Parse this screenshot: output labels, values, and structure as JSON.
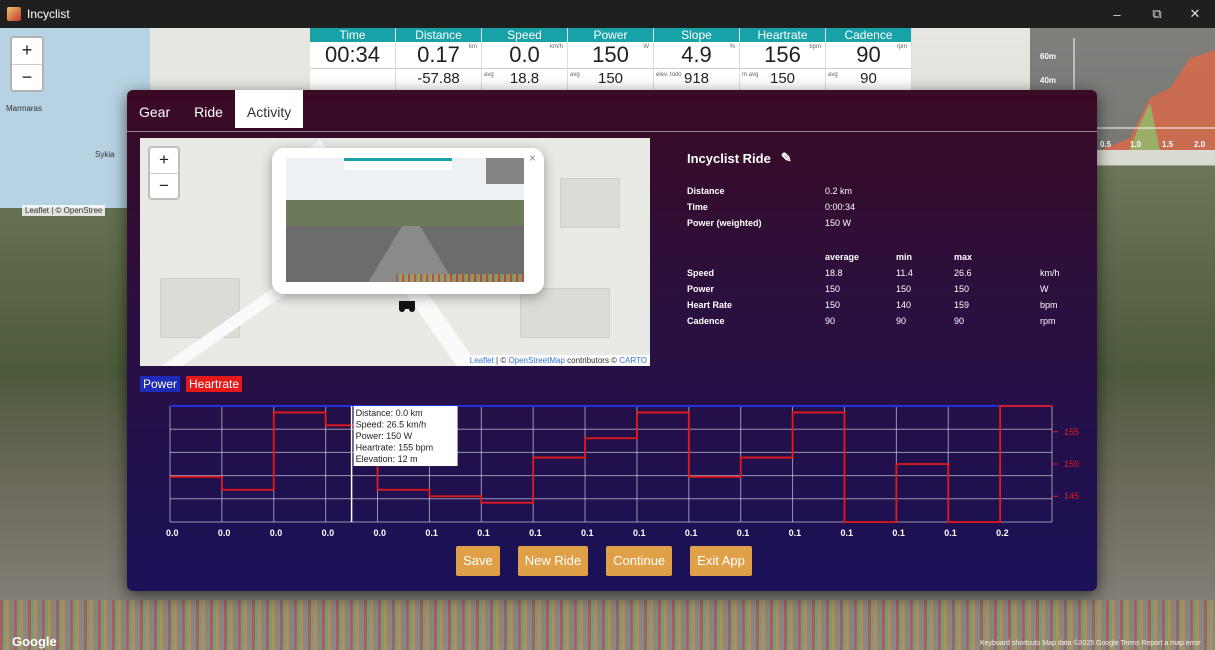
{
  "window": {
    "title": "Incyclist",
    "minimize": "–",
    "maximize": "⧉",
    "close": "✕"
  },
  "background": {
    "map_labels": {
      "marmaras": "Marmaras",
      "sykia": "Sykia",
      "leaflet": "Leaflet | © OpenStree"
    },
    "zoom_in": "+",
    "zoom_out": "−",
    "elevation": {
      "y_ticks": [
        "60m",
        "40m"
      ],
      "x_ticks": [
        "0.5",
        "1.0",
        "1.5",
        "2.0"
      ]
    },
    "google": "Google",
    "terms": "Keyboard shortcuts   Map data ©2025 Google   Terms   Report a map error"
  },
  "metrics": [
    {
      "label": "Time",
      "value": "00:34",
      "unit": "",
      "avg_label": "",
      "sub": ""
    },
    {
      "label": "Distance",
      "value": "0.17",
      "unit": "km",
      "avg_label": "",
      "sub": "-57.88"
    },
    {
      "label": "Speed",
      "value": "0.0",
      "unit": "km/h",
      "avg_label": "avg",
      "sub": "18.8"
    },
    {
      "label": "Power",
      "value": "150",
      "unit": "W",
      "avg_label": "avg",
      "sub": "150"
    },
    {
      "label": "Slope",
      "value": "4.9",
      "unit": "%",
      "avg_label": "elev. todo",
      "sub": "918"
    },
    {
      "label": "Heartrate",
      "value": "156",
      "unit": "bpm",
      "avg_label": "m  avg",
      "sub": "150"
    },
    {
      "label": "Cadence",
      "value": "90",
      "unit": "rpm",
      "avg_label": "avg",
      "sub": "90"
    }
  ],
  "modal": {
    "tabs": [
      {
        "label": "Gear",
        "active": false
      },
      {
        "label": "Ride",
        "active": false
      },
      {
        "label": "Activity",
        "active": true
      }
    ],
    "map": {
      "zoom_in": "+",
      "zoom_out": "−",
      "popup_close": "×",
      "attribution_leaflet": "Leaflet",
      "attribution_sep": " | © ",
      "attribution_osm": "OpenStreetMap",
      "attribution_rest": " contributors © ",
      "attribution_carto": "CARTO"
    },
    "summary": {
      "title": "Incyclist Ride",
      "edit_icon": "✎",
      "distance_label": "Distance",
      "distance_value": "0.2 km",
      "time_label": "Time",
      "time_value": "0:00:34",
      "power_w_label": "Power (weighted)",
      "power_w_value": "150 W",
      "col_average": "average",
      "col_min": "min",
      "col_max": "max",
      "rows": [
        {
          "label": "Speed",
          "avg": "18.8",
          "min": "11.4",
          "max": "26.6",
          "unit": "km/h"
        },
        {
          "label": "Power",
          "avg": "150",
          "min": "150",
          "max": "150",
          "unit": "W"
        },
        {
          "label": "Heart Rate",
          "avg": "150",
          "min": "140",
          "max": "159",
          "unit": "bpm"
        },
        {
          "label": "Cadence",
          "avg": "90",
          "min": "90",
          "max": "90",
          "unit": "rpm"
        }
      ]
    },
    "legend": {
      "power": "Power",
      "heartrate": "Heartrate"
    },
    "tooltip": [
      "Distance: 0.0 km",
      "Speed: 26.5 km/h",
      "Power: 150 W",
      "Heartrate: 155 bpm",
      "Elevation: 12 m"
    ],
    "buttons": {
      "save": "Save",
      "new_ride": "New Ride",
      "continue": "Continue",
      "exit": "Exit App"
    }
  },
  "chart_data": {
    "type": "line",
    "x_tick_labels": [
      "0.0",
      "0.0",
      "0.0",
      "0.0",
      "0.0",
      "0.1",
      "0.1",
      "0.1",
      "0.1",
      "0.1",
      "0.1",
      "0.1",
      "0.1",
      "0.1",
      "0.1",
      "0.1",
      "0.2"
    ],
    "y_right_ticks": [
      155,
      150,
      145
    ],
    "y_right_range": [
      141,
      159
    ],
    "series": [
      {
        "name": "Power",
        "color": "#2030e0",
        "values": [
          150,
          150,
          150,
          150,
          150,
          150,
          150,
          150,
          150,
          150,
          150,
          150,
          150,
          150,
          150,
          150,
          150,
          150
        ]
      },
      {
        "name": "Heartrate",
        "color": "#e41a1a",
        "values": [
          148,
          146,
          158,
          156,
          146,
          145,
          144,
          151,
          154,
          158,
          148,
          151,
          158,
          141,
          150,
          141,
          159,
          159
        ]
      }
    ],
    "grid": true
  }
}
